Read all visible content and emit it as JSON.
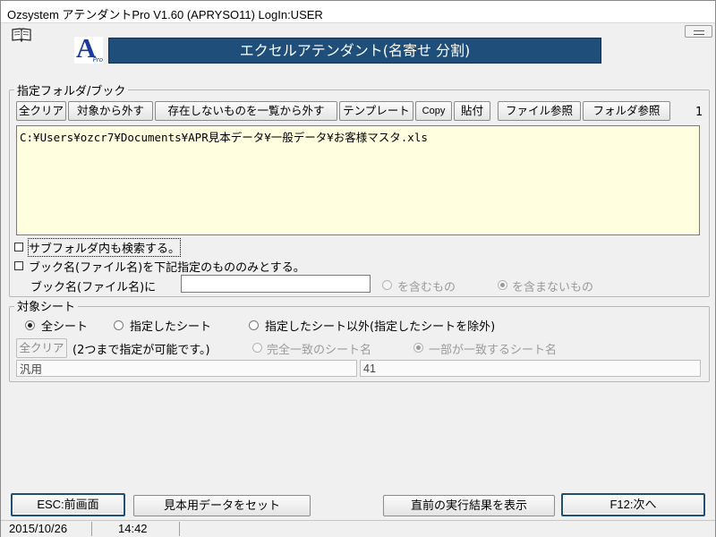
{
  "window": {
    "title": "Ozsystem アテンダントPro V1.60 (APRYSO11)  LogIn:USER"
  },
  "logo": {
    "letter": "A",
    "sub": "Pro"
  },
  "header": {
    "title": "エクセルアテンダント(名寄せ 分割)"
  },
  "folder_group": {
    "legend": "指定フォルダ/ブック",
    "buttons": {
      "clear_all": "全クリア",
      "remove_target": "対象から外す",
      "remove_missing": "存在しないものを一覧から外す",
      "template": "テンプレート",
      "copy": "Copy",
      "paste": "貼付",
      "file_browse": "ファイル参照",
      "folder_browse": "フォルダ参照"
    },
    "count": "1",
    "paths": "C:¥Users¥ozcr7¥Documents¥APR見本データ¥一般データ¥お客様マスタ.xls",
    "search_subfolders_label": "サブフォルダ内も検索する。",
    "book_only_label": "ブック名(ファイル名)を下記指定のもののみとする。",
    "book_name_label": "ブック名(ファイル名)に",
    "book_name_value": "",
    "contains_label": "を含むもの",
    "not_contains_label": "を含まないもの"
  },
  "sheet_group": {
    "legend": "対象シート",
    "all_sheets_label": "全シート",
    "specified_sheets_label": "指定したシート",
    "except_specified_label": "指定したシート以外(指定したシートを除外)",
    "clear_button": "全クリア",
    "note": "(2つまで指定が可能です。)",
    "exact_match_label": "完全一致のシート名",
    "partial_match_label": "一部が一致するシート名",
    "sheet_name_1": "汎用",
    "sheet_name_2": "41"
  },
  "footer": {
    "back_button": "ESC:前画面",
    "sample_button": "見本用データをセット",
    "show_result_button": "直前の実行結果を表示",
    "next_button": "F12:次へ"
  },
  "status": {
    "date": "2015/10/26",
    "time": "14:42"
  }
}
